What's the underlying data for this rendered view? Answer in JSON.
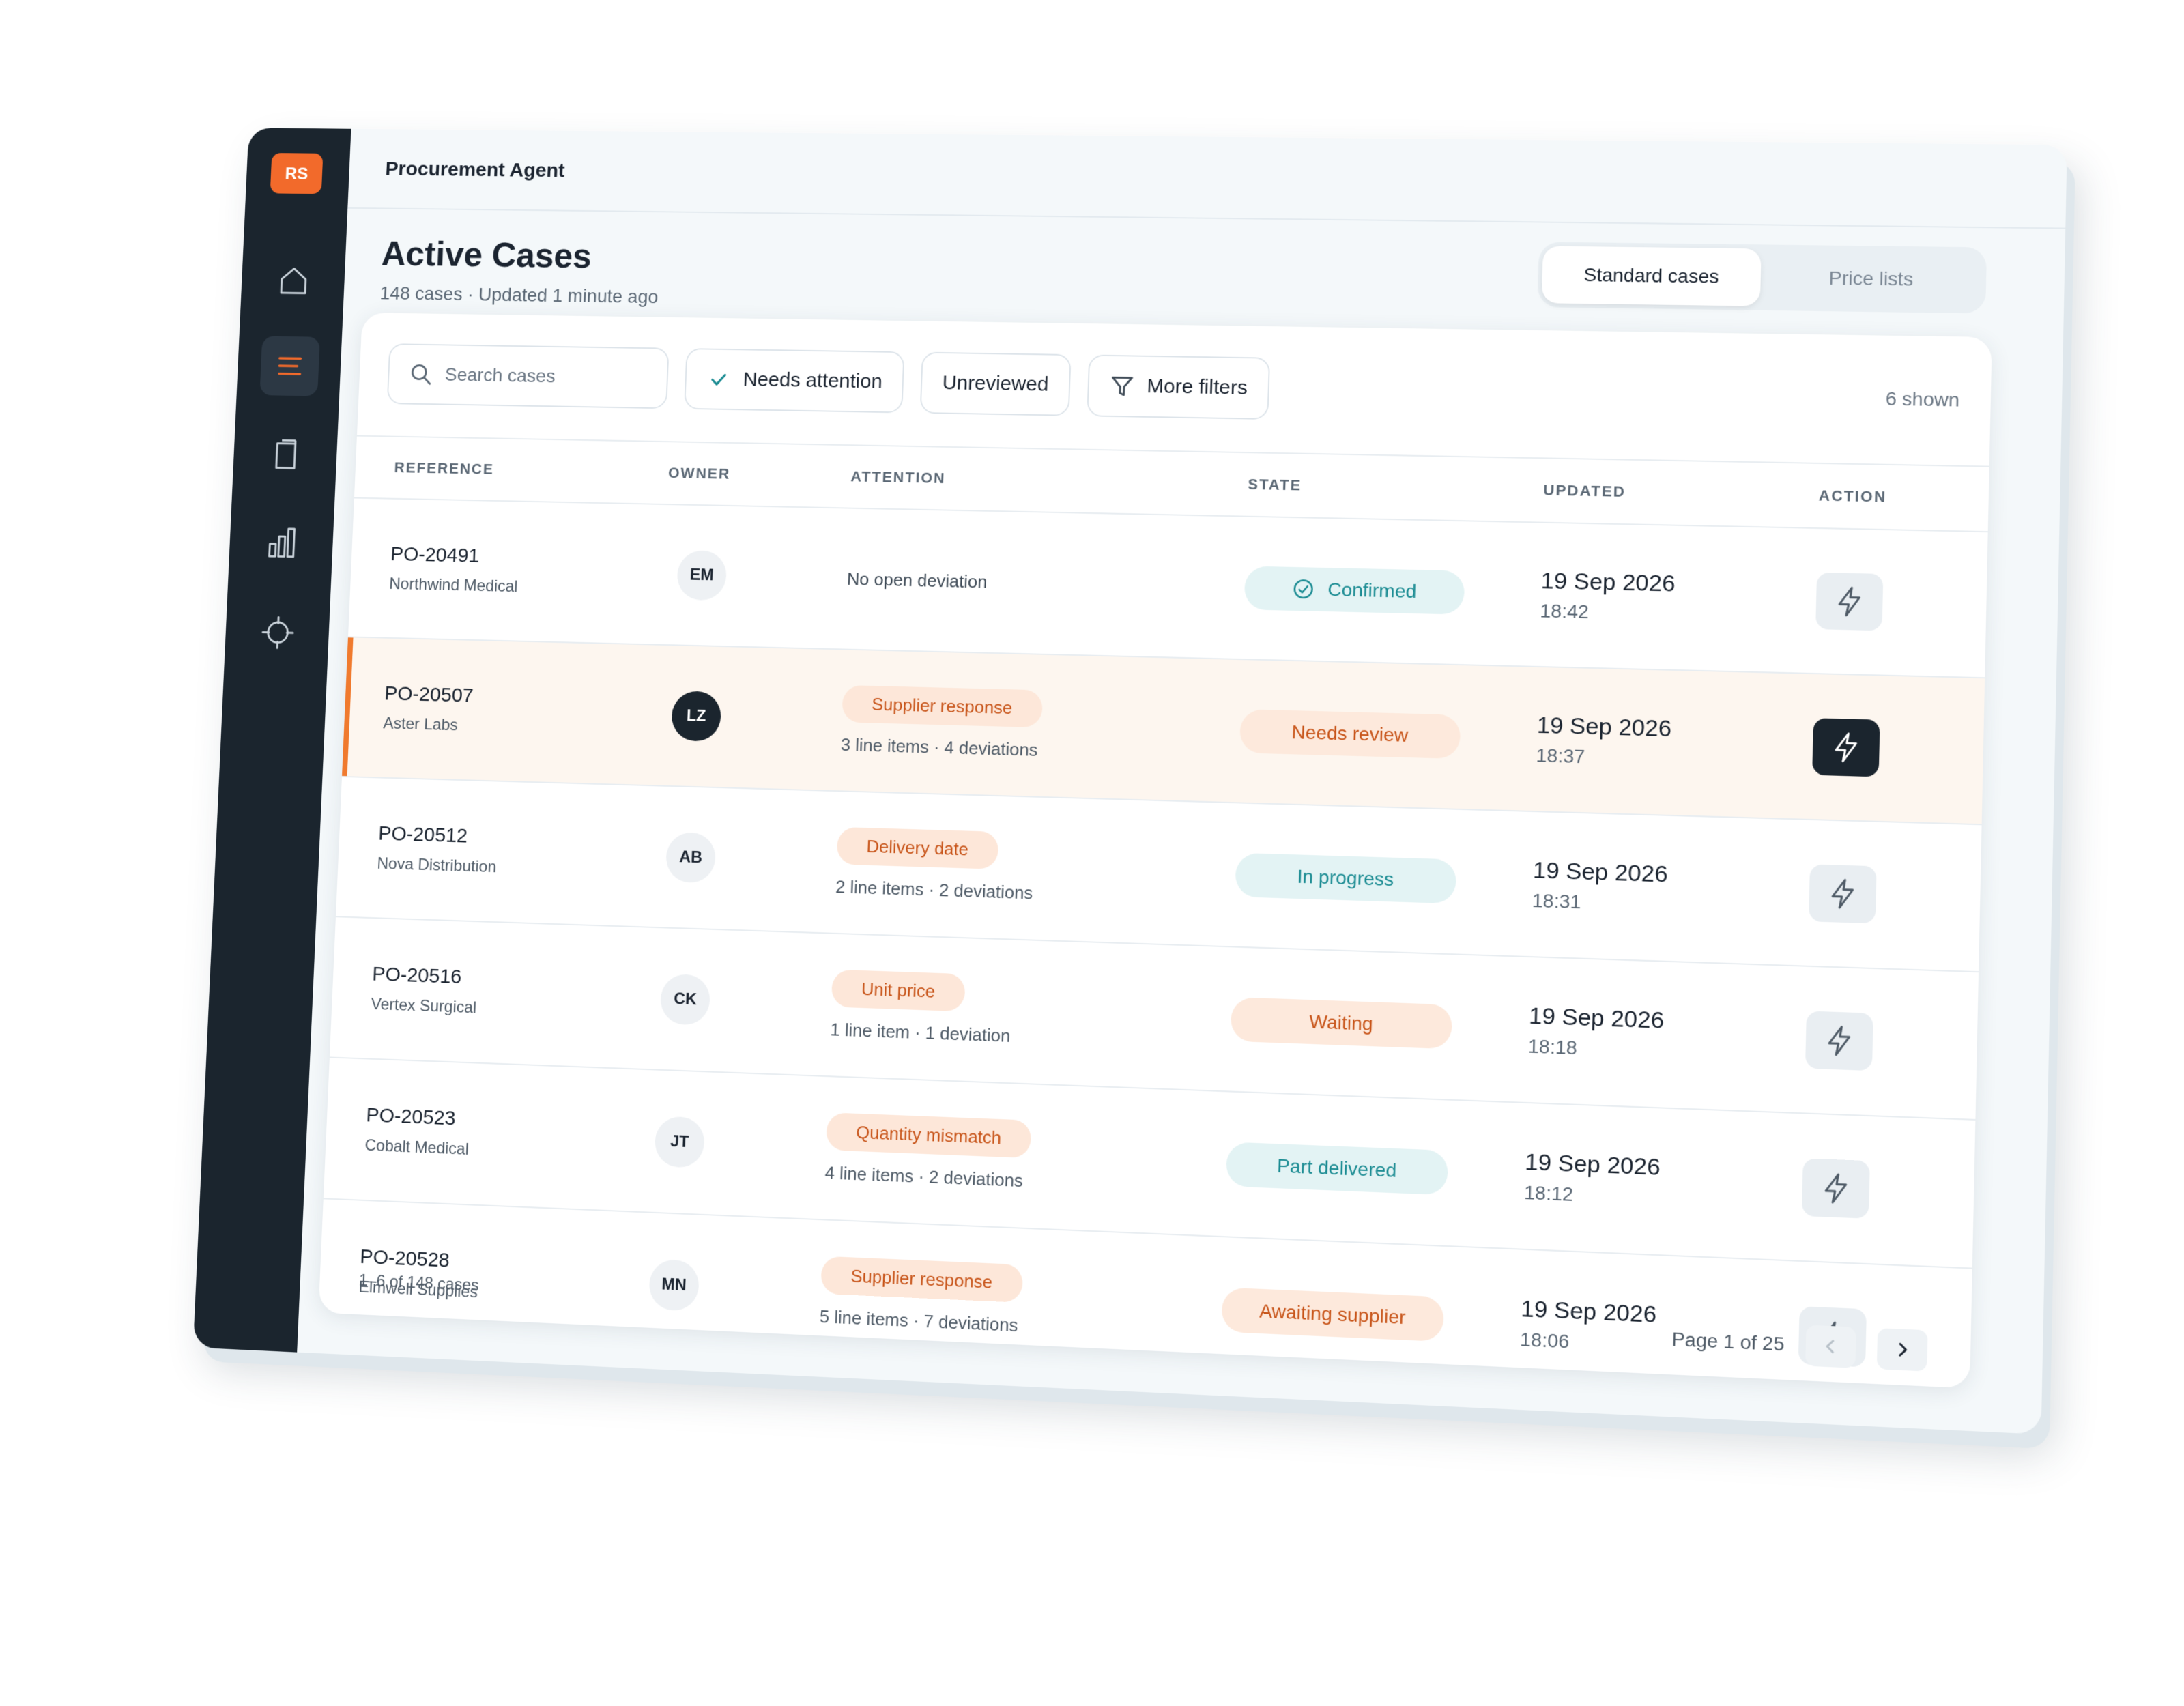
{
  "app": {
    "title": "Procurement Agent",
    "user_initials": "RS",
    "accent_color": "#f26a2b"
  },
  "sidebar": {
    "items": [
      {
        "icon": "home-icon",
        "active": false
      },
      {
        "icon": "list-icon",
        "active": true
      },
      {
        "icon": "clipboard-icon",
        "active": false
      },
      {
        "icon": "bar-chart-icon",
        "active": false
      },
      {
        "icon": "crosshair-icon",
        "active": false
      }
    ]
  },
  "header": {
    "title": "Active Cases",
    "subtitle": "148 cases · Updated 1 minute ago",
    "tabs": [
      {
        "label": "Standard cases",
        "selected": true
      },
      {
        "label": "Price lists",
        "selected": false
      }
    ]
  },
  "filters": {
    "search_placeholder": "Search cases",
    "needs_attention": "Needs attention",
    "unreviewed": "Unreviewed",
    "more_filters": "More filters",
    "shown": "6 shown"
  },
  "table": {
    "columns": [
      "REFERENCE",
      "OWNER",
      "ATTENTION",
      "STATE",
      "UPDATED",
      "ACTION"
    ],
    "rows": [
      {
        "ref": "PO-20491",
        "vendor": "Northwind Medical",
        "owner": "EM",
        "attention": "No open deviation",
        "detail": "",
        "state": "Confirmed",
        "date": "19 Sep 2026",
        "time": "18:42"
      },
      {
        "ref": "PO-20507",
        "vendor": "Aster Labs",
        "owner": "LZ",
        "attention": "Supplier response",
        "detail": "3 line items · 4 deviations",
        "state": "Needs review",
        "date": "19 Sep 2026",
        "time": "18:37"
      },
      {
        "ref": "PO-20512",
        "vendor": "Nova Distribution",
        "owner": "AB",
        "attention": "Delivery date",
        "detail": "2 line items · 2 deviations",
        "state": "In progress",
        "date": "19 Sep 2026",
        "time": "18:31"
      },
      {
        "ref": "PO-20516",
        "vendor": "Vertex Surgical",
        "owner": "CK",
        "attention": "Unit price",
        "detail": "1 line item · 1 deviation",
        "state": "Waiting",
        "date": "19 Sep 2026",
        "time": "18:18"
      },
      {
        "ref": "PO-20523",
        "vendor": "Cobalt Medical",
        "owner": "JT",
        "attention": "Quantity mismatch",
        "detail": "4 line items · 2 deviations",
        "state": "Part delivered",
        "date": "19 Sep 2026",
        "time": "18:12"
      },
      {
        "ref": "PO-20528",
        "vendor": "Elmwell Supplies",
        "owner": "MN",
        "attention": "Supplier response",
        "detail": "5 line items · 7 deviations",
        "state": "Awaiting supplier",
        "date": "19 Sep 2026",
        "time": "18:06"
      }
    ]
  },
  "footer": {
    "count": "1–6 of 148 cases",
    "page": "Page 1 of 25"
  }
}
